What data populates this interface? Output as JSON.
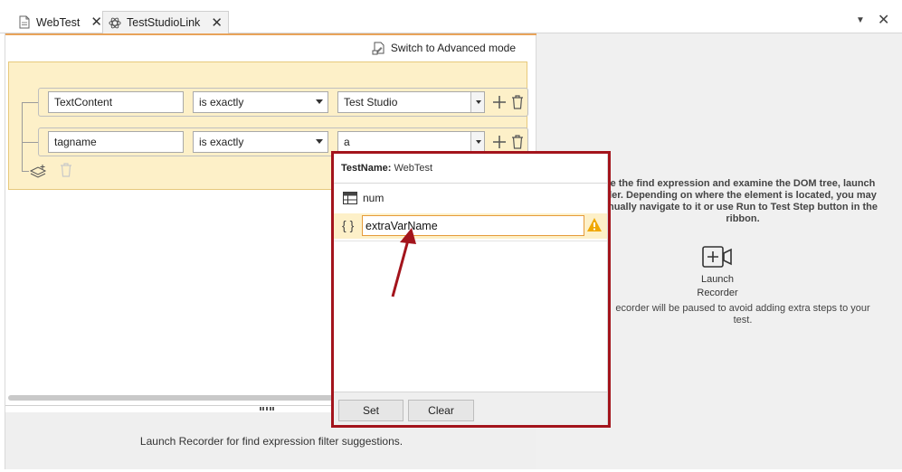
{
  "tabs": [
    {
      "label": "WebTest",
      "close": "✕"
    },
    {
      "label": "TestStudioLink",
      "close": "✕"
    }
  ],
  "window_controls": {
    "dropdown": "▼",
    "close": "✕"
  },
  "left": {
    "advanced_mode": "Switch to Advanced mode",
    "filters": [
      {
        "attribute": "TextContent",
        "operator": "is exactly",
        "value": "Test Studio"
      },
      {
        "attribute": "tagname",
        "operator": "is exactly",
        "value": "a"
      }
    ],
    "bottom_hint": "Launch Recorder for find expression filter suggestions."
  },
  "right": {
    "instructions_lines": [
      "e the find expression and examine the DOM tree, launch",
      "ler. Depending on where the element is located, you may",
      "nually navigate to it or use Run to Test Step button in the",
      "ribbon."
    ],
    "launch_label_1": "Launch",
    "launch_label_2": "Recorder",
    "note_lines": [
      "ecorder will be paused to avoid adding extra steps to your",
      "test."
    ]
  },
  "popup": {
    "test_name_label": "TestName:",
    "test_name_value": "WebTest",
    "items": [
      {
        "label": "num",
        "icon": "table-icon"
      }
    ],
    "variable_input_value": "extraVarName",
    "braces": "{ }",
    "set_label": "Set",
    "clear_label": "Clear"
  },
  "colors": {
    "highlight_frame": "#a3141c",
    "filter_bg": "#fdf0c8",
    "accent_orange": "#e8a35a",
    "warning": "#f0a800"
  }
}
